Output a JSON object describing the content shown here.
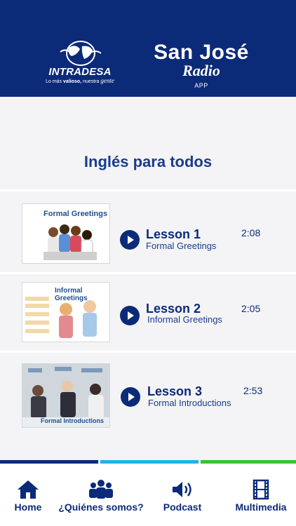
{
  "header": {
    "left_logo": {
      "name": "INTRADESA",
      "tagline_prefix": "Lo más",
      "tagline_bold": "valioso,",
      "tagline_mid": "nuestra",
      "tagline_script": "gente"
    },
    "right_logo": {
      "line1": "San José",
      "line2": "Radio",
      "line3": "APP"
    }
  },
  "page": {
    "title": "Inglés para todos"
  },
  "lessons": [
    {
      "title": "Lesson 1",
      "subtitle": "Formal Greetings",
      "duration": "2:08",
      "thumb_caption": "Formal Greetings"
    },
    {
      "title": "Lesson 2",
      "subtitle": "Informal Greetings",
      "duration": "2:05",
      "thumb_caption": "Informal Greetings"
    },
    {
      "title": "Lesson 3",
      "subtitle": "Formal Introductions",
      "duration": "2:53",
      "thumb_caption": "Formal Introductions"
    }
  ],
  "accent_colors": {
    "primary": "#0b2a78",
    "light_blue": "#22b4e6",
    "green": "#35c531"
  },
  "tabs": [
    {
      "label": "Home",
      "icon": "home-icon"
    },
    {
      "label": "¿Quiénes somos?",
      "icon": "group-icon"
    },
    {
      "label": "Podcast",
      "icon": "speaker-icon"
    },
    {
      "label": "Multimedia",
      "icon": "film-icon"
    }
  ]
}
